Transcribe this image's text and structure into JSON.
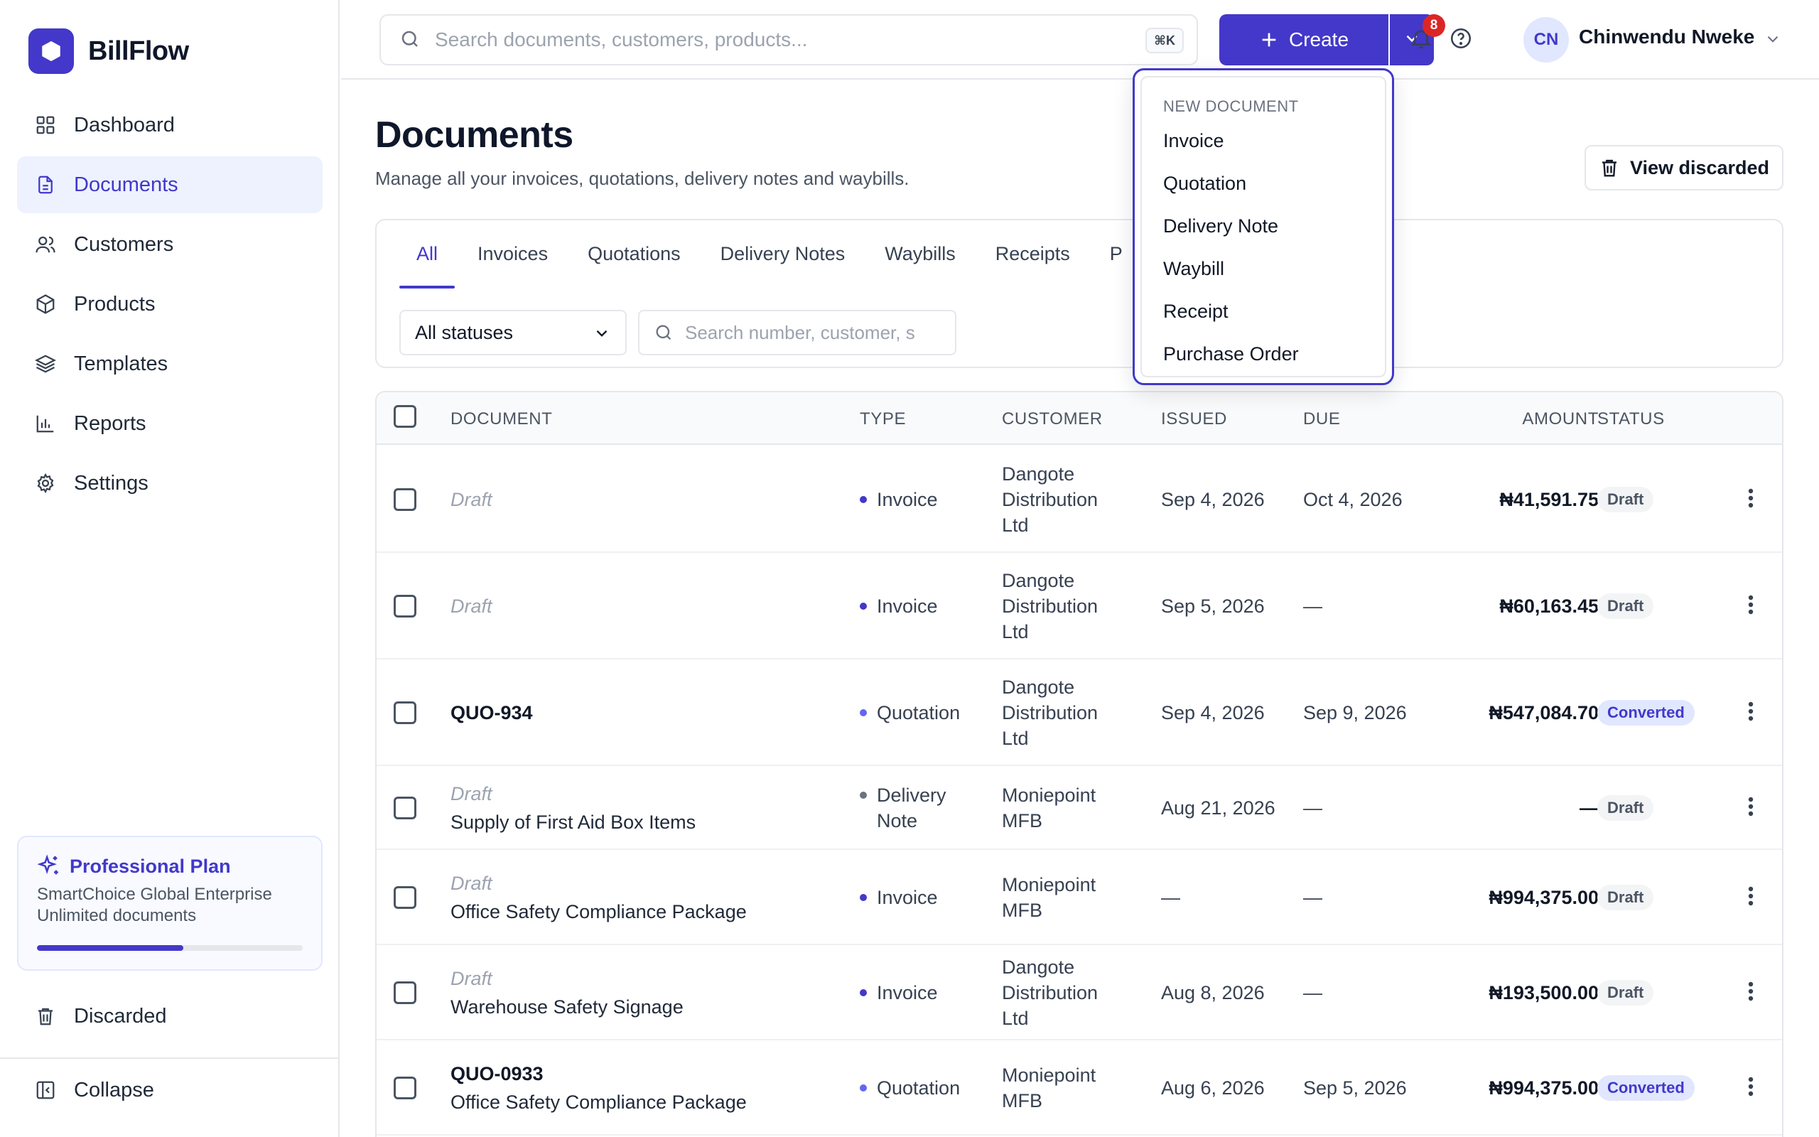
{
  "app": {
    "name": "BillFlow"
  },
  "sidebar": {
    "items": [
      {
        "label": "Dashboard",
        "icon": "dashboard-icon"
      },
      {
        "label": "Documents",
        "icon": "document-icon",
        "active": true
      },
      {
        "label": "Customers",
        "icon": "users-icon"
      },
      {
        "label": "Products",
        "icon": "box-icon"
      },
      {
        "label": "Templates",
        "icon": "layers-icon"
      },
      {
        "label": "Reports",
        "icon": "chart-icon"
      },
      {
        "label": "Settings",
        "icon": "gear-icon"
      }
    ],
    "plan": {
      "title": "Professional Plan",
      "company": "SmartChoice Global Enterprise",
      "quota": "Unlimited documents",
      "usage_fraction": 0.55
    },
    "discarded_label": "Discarded",
    "collapse_label": "Collapse"
  },
  "topbar": {
    "search_placeholder": "Search documents, customers, products...",
    "shortcut": "⌘K",
    "create_label": "Create",
    "notification_count": "8",
    "user_initials": "CN",
    "user_name": "Chinwendu Nweke"
  },
  "page": {
    "title": "Documents",
    "subtitle": "Manage all your invoices, quotations, delivery notes and waybills.",
    "view_discarded_label": "View discarded"
  },
  "filters": {
    "tabs": [
      "All",
      "Invoices",
      "Quotations",
      "Delivery Notes",
      "Waybills",
      "Receipts",
      "P"
    ],
    "active_tab": "All",
    "status_value": "All statuses",
    "search_placeholder": "Search number, customer, s"
  },
  "dropdown": {
    "heading": "NEW DOCUMENT",
    "items": [
      "Invoice",
      "Quotation",
      "Delivery Note",
      "Waybill",
      "Receipt",
      "Purchase Order"
    ]
  },
  "table": {
    "headers": {
      "document": "DOCUMENT",
      "type": "TYPE",
      "customer": "CUSTOMER",
      "issued": "ISSUED",
      "due": "DUE",
      "amount": "AMOUNT",
      "status": "STATUS"
    },
    "rows": [
      {
        "doc": "Draft",
        "doc_draft": true,
        "desc": "",
        "type_line1": "Invoice",
        "type_line2": "",
        "type_color": "#4338ca",
        "cust1": "Dangote",
        "cust2": "Distribution",
        "cust3": "Ltd",
        "issued": "Sep 4, 2026",
        "due": "Oct 4, 2026",
        "amount": "₦41,591.75",
        "status": "Draft",
        "status_kind": "draft"
      },
      {
        "doc": "Draft",
        "doc_draft": true,
        "desc": "",
        "type_line1": "Invoice",
        "type_line2": "",
        "type_color": "#4338ca",
        "cust1": "Dangote",
        "cust2": "Distribution",
        "cust3": "Ltd",
        "issued": "Sep 5, 2026",
        "due": "—",
        "amount": "₦60,163.45",
        "status": "Draft",
        "status_kind": "draft"
      },
      {
        "doc": "QUO-934",
        "doc_draft": false,
        "desc": "",
        "type_line1": "Quotation",
        "type_line2": "",
        "type_color": "#6366f1",
        "cust1": "Dangote",
        "cust2": "Distribution",
        "cust3": "Ltd",
        "issued": "Sep 4, 2026",
        "due": "Sep 9, 2026",
        "amount": "₦547,084.70",
        "status": "Converted",
        "status_kind": "converted"
      },
      {
        "doc": "Draft",
        "doc_draft": true,
        "desc": "Supply of First Aid Box Items",
        "type_line1": "Delivery",
        "type_line2": "Note",
        "type_color": "#6b7280",
        "cust1": "Moniepoint",
        "cust2": "MFB",
        "cust3": "",
        "issued": "Aug 21, 2026",
        "due": "—",
        "amount": "—",
        "status": "Draft",
        "status_kind": "draft"
      },
      {
        "doc": "Draft",
        "doc_draft": true,
        "desc": "Office Safety Compliance Package",
        "type_line1": "Invoice",
        "type_line2": "",
        "type_color": "#4338ca",
        "cust1": "Moniepoint",
        "cust2": "MFB",
        "cust3": "",
        "issued": "—",
        "due": "—",
        "amount": "₦994,375.00",
        "status": "Draft",
        "status_kind": "draft"
      },
      {
        "doc": "Draft",
        "doc_draft": true,
        "desc": "Warehouse Safety Signage",
        "type_line1": "Invoice",
        "type_line2": "",
        "type_color": "#4338ca",
        "cust1": "Dangote",
        "cust2": "Distribution",
        "cust3": "Ltd",
        "issued": "Aug 8, 2026",
        "due": "—",
        "amount": "₦193,500.00",
        "status": "Draft",
        "status_kind": "draft"
      },
      {
        "doc": "QUO-0933",
        "doc_draft": false,
        "desc": "Office Safety Compliance Package",
        "type_line1": "Quotation",
        "type_line2": "",
        "type_color": "#6366f1",
        "cust1": "Moniepoint",
        "cust2": "MFB",
        "cust3": "",
        "issued": "Aug 6, 2026",
        "due": "Sep 5, 2026",
        "amount": "₦994,375.00",
        "status": "Converted",
        "status_kind": "converted"
      }
    ]
  },
  "colors": {
    "accent": "#4338ca",
    "accent_soft": "#eef2ff",
    "danger": "#dc2626"
  }
}
